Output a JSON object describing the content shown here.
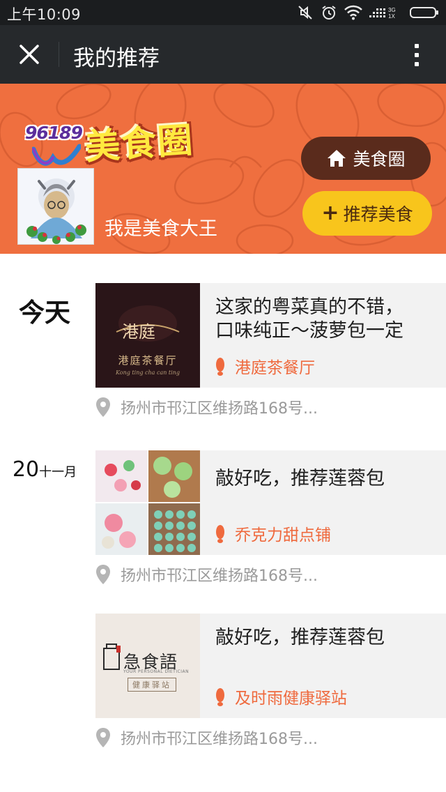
{
  "status_bar": {
    "time": "上午10:09",
    "signal_label": "3G\n1X"
  },
  "titlebar": {
    "title": "我的推荐",
    "close_icon": "close-icon",
    "more_icon": "more-vertical-icon"
  },
  "banner": {
    "logo_number": "96189",
    "logo_title": "美食圈",
    "user_name": "我是美食大王",
    "food_circle_button": "美食圈",
    "recommend_button": "推荐美食",
    "colors": {
      "banner_bg": "#ef6f3f",
      "dark_pill": "#5a2b1c",
      "yellow_pill": "#f8c51c"
    }
  },
  "feed": {
    "groups": [
      {
        "date_main": "今天",
        "date_suffix": "",
        "posts": [
          {
            "text": "这家的粤菜真的不错，\n口味纯正～菠萝包一定",
            "shop": "港庭茶餐厅",
            "address": "扬州市邗江区维扬路168号...",
            "thumb": {
              "logo": "港庭",
              "name": "港庭茶餐厅",
              "subtitle": "Kong ting cha can ting"
            }
          }
        ]
      },
      {
        "date_main": "20",
        "date_suffix": "十一月",
        "posts": [
          {
            "text": "敲好吃，推荐莲蓉包",
            "shop": "乔克力甜点铺",
            "address": "扬州市邗江区维扬路168号..."
          },
          {
            "text": "敲好吃，推荐莲蓉包",
            "shop": "及时雨健康驿站",
            "address": "扬州市邗江区维扬路168号...",
            "thumb": {
              "name": "急食語",
              "subtitle": "YOUR PERSONAL DIETICIAN",
              "tag": "健康驿站"
            }
          }
        ]
      }
    ]
  },
  "colors": {
    "accent_orange": "#ef6a3e",
    "address_gray": "#9a9a9a",
    "titlebar_bg": "#26292c"
  }
}
